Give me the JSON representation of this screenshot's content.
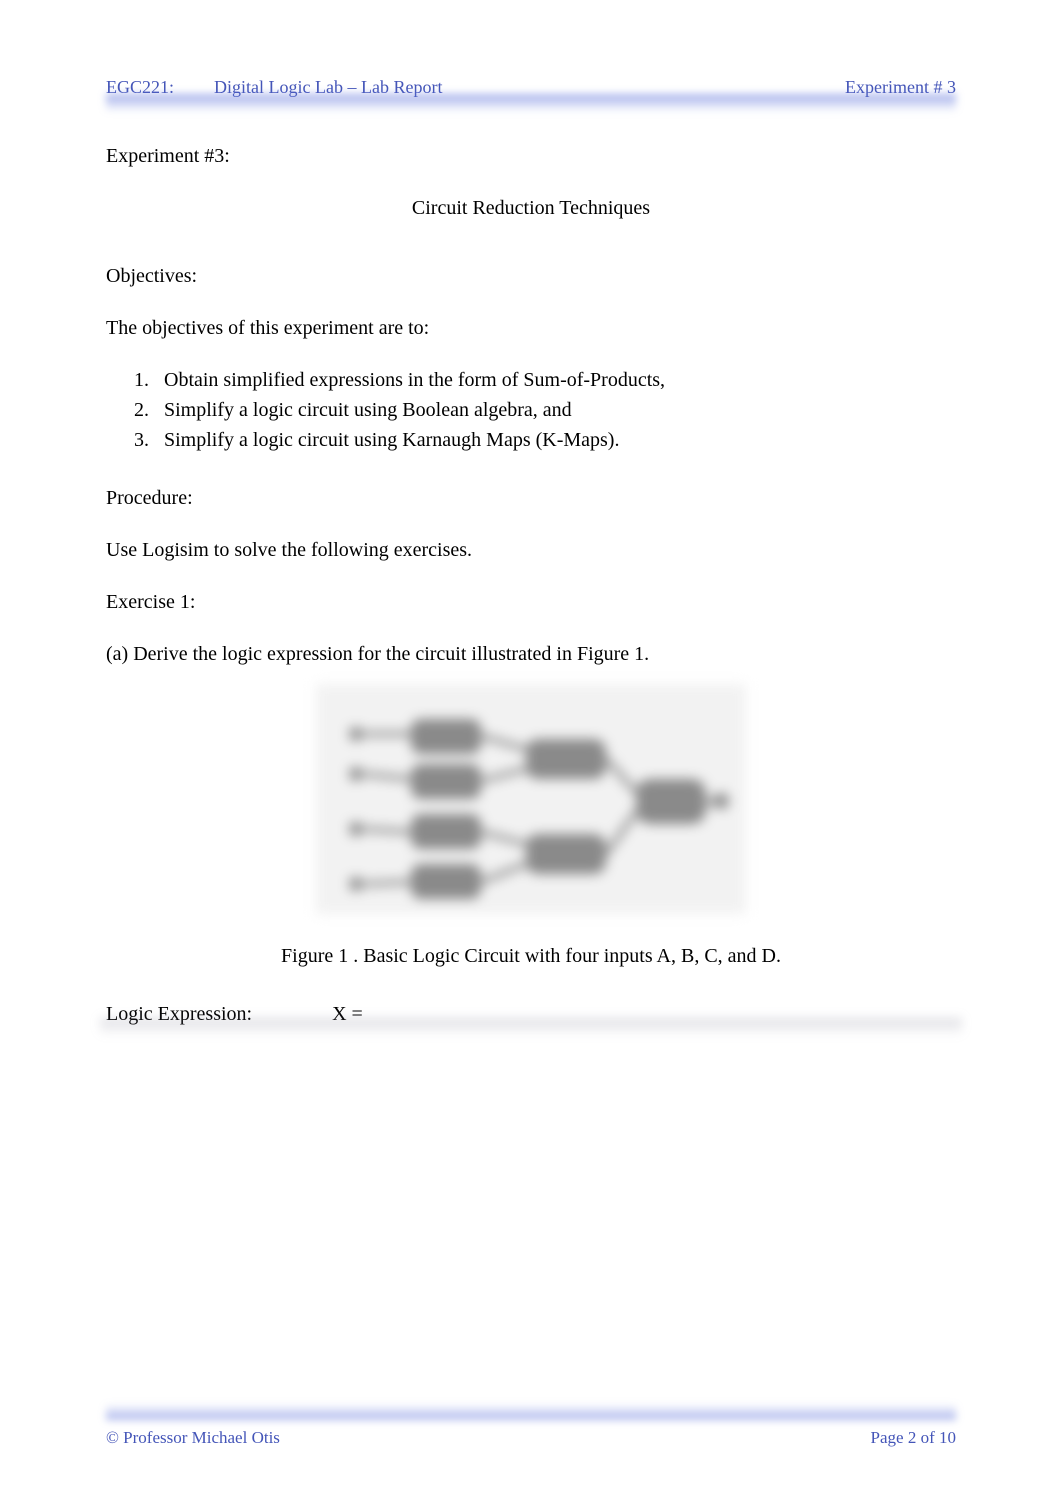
{
  "header": {
    "course": "EGC221:",
    "title": "Digital Logic Lab – Lab Report",
    "right": "Experiment # 3"
  },
  "experiment_label": "Experiment #3:",
  "experiment_title": "Circuit Reduction Techniques",
  "objectives_heading": "Objectives:",
  "objectives_intro": "The objectives of this experiment are to:",
  "objectives": [
    "Obtain simplified expressions in the form of Sum-of-Products,",
    "Simplify a logic circuit using Boolean algebra, and",
    "Simplify a logic circuit using Karnaugh Maps (K-Maps)."
  ],
  "procedure_heading": "Procedure:",
  "procedure_text": "Use Logisim to solve the following exercises.",
  "exercise_heading": "Exercise 1:",
  "exercise_prompt": "(a) Derive the logic expression for the circuit illustrated in Figure 1.",
  "figure_caption": "Figure 1  . Basic Logic Circuit with four inputs A, B, C, and D.",
  "logic_label": "Logic Expression:",
  "logic_value": "X =",
  "footer": {
    "left": "© Professor Michael Otis",
    "right": "Page 2 of 10"
  }
}
